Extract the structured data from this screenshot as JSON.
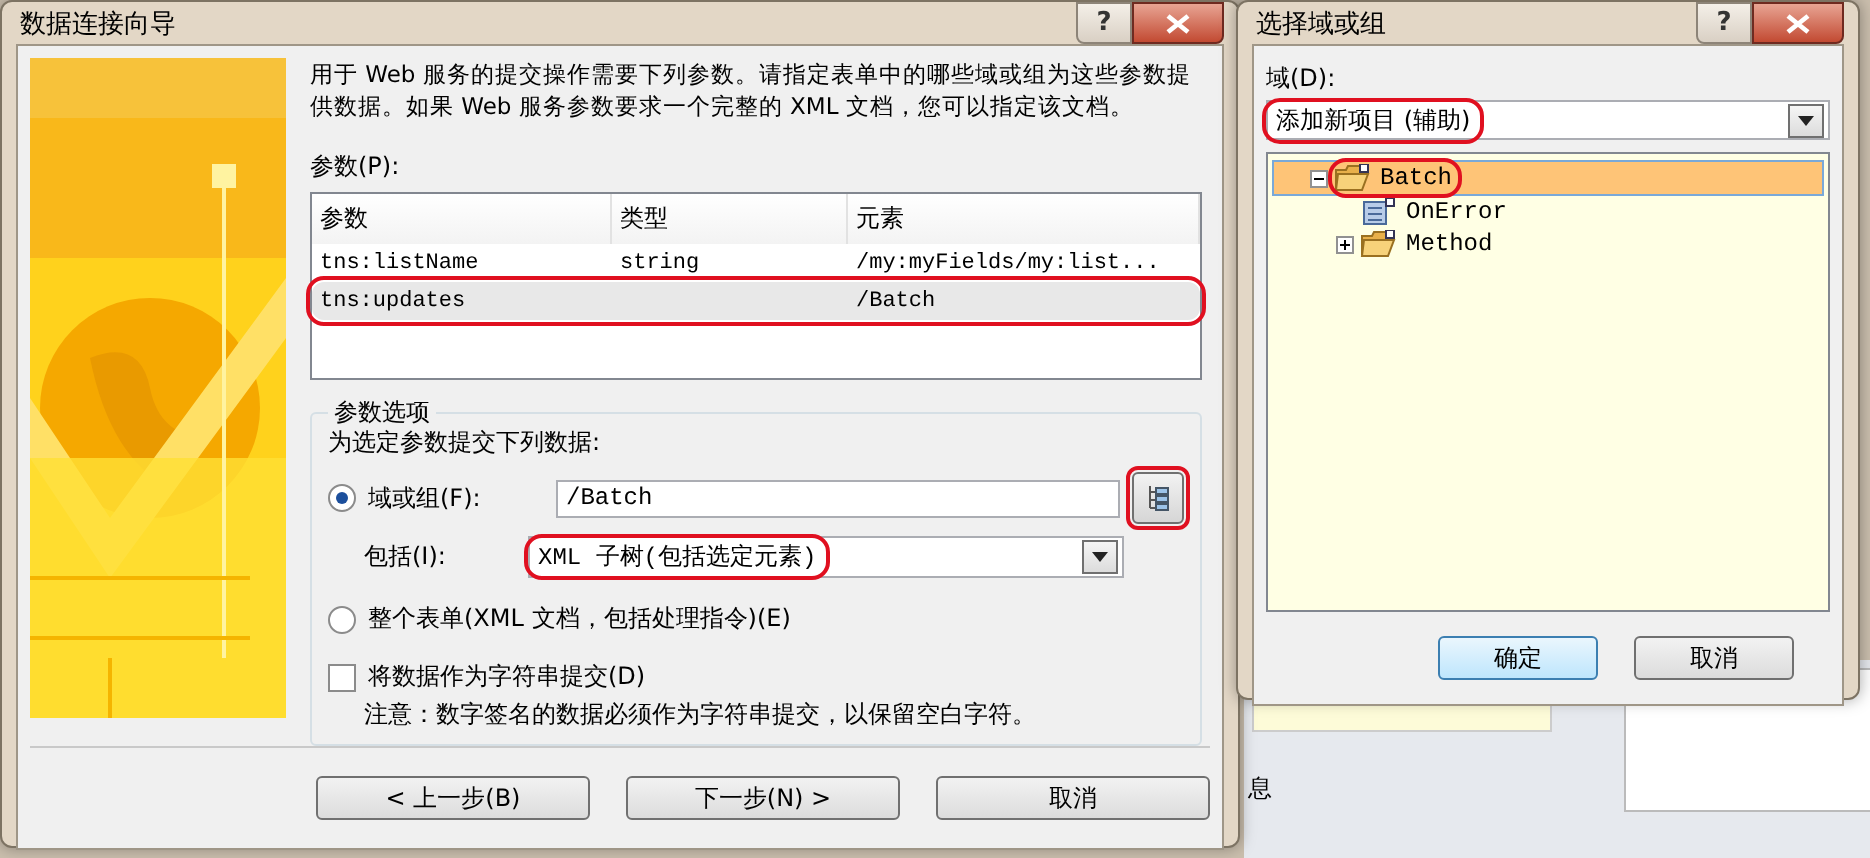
{
  "background_window": {
    "label": "息"
  },
  "wizard": {
    "title": "数据连接向导",
    "help": "?",
    "description": "用于 Web 服务的提交操作需要下列参数。请指定表单中的哪些域或组为这些参数提供数据。如果 Web 服务参数要求一个完整的 XML 文档，您可以指定该文档。",
    "params_label": "参数(P):",
    "table": {
      "columns": [
        "参数",
        "类型",
        "元素"
      ],
      "rows": [
        {
          "cells": [
            "tns:listName",
            "string",
            "/my:myFields/my:list..."
          ],
          "selected": false,
          "annotated": false
        },
        {
          "cells": [
            "tns:updates",
            "",
            "/Batch"
          ],
          "selected": true,
          "annotated": true
        }
      ]
    },
    "options": {
      "legend": "参数选项",
      "prompt": "为选定参数提交下列数据:",
      "field_or_group": {
        "label": "域或组(F):",
        "selected": true,
        "value": "/Batch"
      },
      "tree_button": {
        "annotated": true
      },
      "include": {
        "label": "包括(I):",
        "value": "XML 子树(包括选定元素)",
        "annotated": true
      },
      "whole_form": {
        "label": "整个表单(XML 文档，包括处理指令)(E)",
        "selected": false
      },
      "as_string": {
        "label": "将数据作为字符串提交(D)",
        "checked": false
      },
      "note": "注意：数字签名的数据必须作为字符串提交，以保留空白字符。"
    },
    "buttons": [
      "< 上一步(B)",
      "下一步(N) >",
      "取消"
    ]
  },
  "picker": {
    "title": "选择域或组",
    "help": "?",
    "field_label": "域(D):",
    "field_value": "添加新项目 (辅助)",
    "field_annotated": true,
    "tree": [
      {
        "label": "Batch",
        "kind": "group",
        "expanded": true,
        "selected": true,
        "annotated": true,
        "children": [
          {
            "label": "OnError",
            "kind": "field"
          },
          {
            "label": "Method",
            "kind": "group",
            "expanded": false
          }
        ]
      }
    ],
    "buttons": [
      "确定",
      "取消"
    ]
  }
}
